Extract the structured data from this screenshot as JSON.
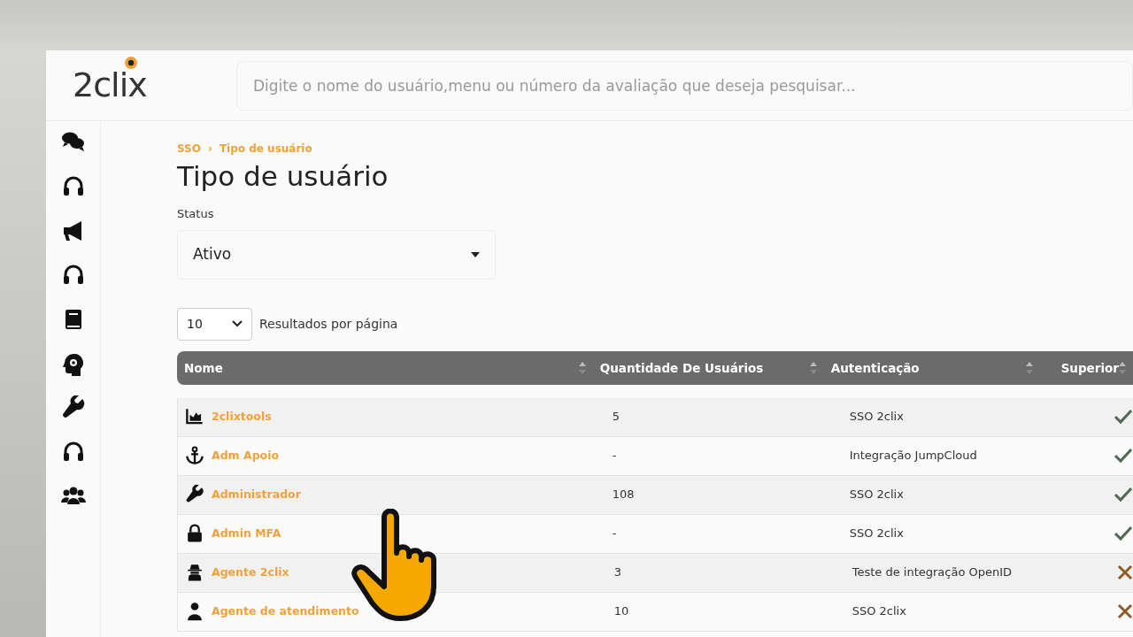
{
  "logo": {
    "text": "2clix"
  },
  "search": {
    "placeholder": "Digite o nome do usuário,menu ou número da avaliação que deseja pesquisar..."
  },
  "sidebar": {
    "items": [
      {
        "kind": "chat"
      },
      {
        "kind": "headset"
      },
      {
        "kind": "megaphone"
      },
      {
        "kind": "headset"
      },
      {
        "kind": "book"
      },
      {
        "kind": "head-gear"
      },
      {
        "kind": "wrench"
      },
      {
        "kind": "headset"
      },
      {
        "kind": "users"
      }
    ]
  },
  "breadcrumb": {
    "items": [
      "SSO",
      "Tipo de usuário"
    ],
    "separator": "›"
  },
  "page_title": "Tipo de usuário",
  "status_filter": {
    "label": "Status",
    "value": "Ativo"
  },
  "page_size": {
    "value": "10",
    "label": "Resultados por página"
  },
  "table": {
    "columns": [
      "Nome",
      "Quantidade De Usuários",
      "Autenticação",
      "Superior"
    ],
    "rows": [
      {
        "kind": "chart",
        "name": "2clixtools",
        "count": "5",
        "auth": "SSO 2clix",
        "superior": true
      },
      {
        "kind": "anchor",
        "name": "Adm Apoio",
        "count": "-",
        "auth": "Integração JumpCloud",
        "superior": true
      },
      {
        "kind": "wrench",
        "name": "Administrador",
        "count": "108",
        "auth": "SSO 2clix",
        "superior": true
      },
      {
        "kind": "lock",
        "name": "Admin MFA",
        "count": "-",
        "auth": "SSO 2clix",
        "superior": true
      },
      {
        "kind": "spy",
        "name": "Agente 2clix",
        "count": "3",
        "auth": "Teste de integração OpenID",
        "superior": false
      },
      {
        "kind": "user",
        "name": "Agente de atendimento",
        "count": "10",
        "auth": "SSO 2clix",
        "superior": false
      }
    ]
  }
}
